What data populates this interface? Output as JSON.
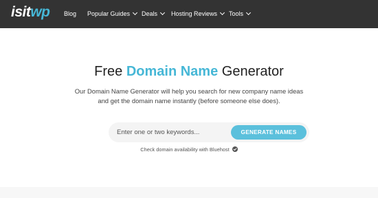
{
  "brand": {
    "logo_part1": "isit",
    "logo_part2": "wp",
    "accent_color": "#46b7d6"
  },
  "nav": {
    "items": [
      {
        "label": "Blog",
        "has_dropdown": false
      },
      {
        "label": "Popular Guides",
        "has_dropdown": true
      },
      {
        "label": "Deals",
        "has_dropdown": true
      },
      {
        "label": "Hosting Reviews",
        "has_dropdown": true
      },
      {
        "label": "Tools",
        "has_dropdown": true
      }
    ]
  },
  "hero": {
    "title_prefix": "Free ",
    "title_highlight": "Domain Name",
    "title_suffix": " Generator",
    "description": "Our Domain Name Generator will help you search for new company name ideas and get the domain name instantly (before someone else does)."
  },
  "search": {
    "placeholder": "Enter one or two keywords...",
    "button_label": "GENERATE NAMES",
    "availability_text": "Check domain availability with Bluehost",
    "availability_icon": "check-circle-icon"
  }
}
